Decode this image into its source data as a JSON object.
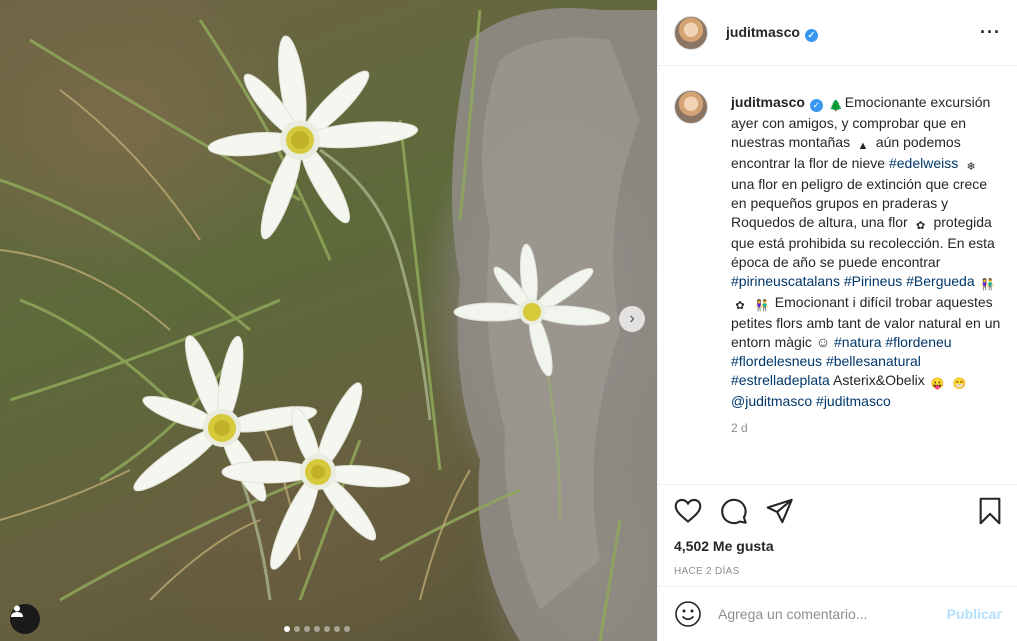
{
  "post": {
    "username": "juditmasco",
    "verified_icon": "verified-badge-icon",
    "more_icon": "more-options-icon",
    "caption": {
      "username": "juditmasco",
      "segments": [
        {
          "type": "emoji",
          "name": "evergreen-tree-icon",
          "glyph": "🌲"
        },
        {
          "type": "text",
          "value": "Emocionante excursión ayer con amigos, y comprobar que en nuestras montañas "
        },
        {
          "type": "emoji",
          "name": "mountain-icon",
          "glyph": "▲"
        },
        {
          "type": "text",
          "value": " aún podemos encontrar la flor de nieve "
        },
        {
          "type": "tag",
          "value": "#edelweiss"
        },
        {
          "type": "text",
          "value": " "
        },
        {
          "type": "emoji",
          "name": "snowflake-icon",
          "glyph": "❄"
        },
        {
          "type": "text",
          "value": " una flor en peligro de extinción que crece en pequeños grupos en praderas y Roquedos de altura, una flor "
        },
        {
          "type": "emoji",
          "name": "hibiscus-icon",
          "glyph": "✿"
        },
        {
          "type": "text",
          "value": " protegida que está prohibida su recolección. En esta época de año se puede encontrar "
        },
        {
          "type": "tag",
          "value": "#pirineuscatalans"
        },
        {
          "type": "text",
          "value": " "
        },
        {
          "type": "tag",
          "value": "#Pirineus"
        },
        {
          "type": "text",
          "value": " "
        },
        {
          "type": "tag",
          "value": "#Bergueda"
        },
        {
          "type": "text",
          "value": " "
        },
        {
          "type": "emoji",
          "name": "couple-icon",
          "glyph": "👫"
        },
        {
          "type": "text",
          "value": " "
        },
        {
          "type": "emoji",
          "name": "hibiscus-icon",
          "glyph": "✿"
        },
        {
          "type": "text",
          "value": " "
        },
        {
          "type": "emoji",
          "name": "couple-icon",
          "glyph": "👫"
        },
        {
          "type": "text",
          "value": " Emocionant i difícil trobar aquestes petites flors amb tant de valor natural en un entorn màgic ☺ "
        },
        {
          "type": "tag",
          "value": "#natura"
        },
        {
          "type": "text",
          "value": " "
        },
        {
          "type": "tag",
          "value": "#flordeneu"
        },
        {
          "type": "text",
          "value": " "
        },
        {
          "type": "tag",
          "value": "#flordelesneus"
        },
        {
          "type": "text",
          "value": " "
        },
        {
          "type": "tag",
          "value": "#bellesanatural"
        },
        {
          "type": "text",
          "value": " "
        },
        {
          "type": "tag",
          "value": "#estrelladeplata"
        },
        {
          "type": "text",
          "value": " Asterix&Obelix "
        },
        {
          "type": "emoji",
          "name": "tongue-face-icon",
          "glyph": "😛"
        },
        {
          "type": "text",
          "value": " "
        },
        {
          "type": "emoji",
          "name": "grinning-face-icon",
          "glyph": "😁"
        },
        {
          "type": "text",
          "value": " "
        },
        {
          "type": "tag",
          "value": "@juditmasco"
        },
        {
          "type": "text",
          "value": " "
        },
        {
          "type": "tag",
          "value": "#juditmasco"
        }
      ],
      "time": "2 d"
    },
    "actions": {
      "like_icon": "heart-icon",
      "comment_icon": "comment-icon",
      "share_icon": "share-icon",
      "save_icon": "bookmark-icon"
    },
    "likes": "4,502 Me gusta",
    "posted_ago": "HACE 2 DÍAS",
    "comment_box": {
      "emoji_icon": "emoji-icon",
      "placeholder": "Agrega un comentario...",
      "value": "",
      "submit_label": "Publicar"
    },
    "carousel": {
      "slides": 7,
      "active_index": 0,
      "next_icon": "chevron-right-icon",
      "tag_icon": "user-tag-icon"
    },
    "colors": {
      "accent": "#3897f0",
      "hashtag": "#00376b",
      "publish_disabled": "#b2dffc",
      "meta_gray": "#8e8e8e"
    }
  }
}
